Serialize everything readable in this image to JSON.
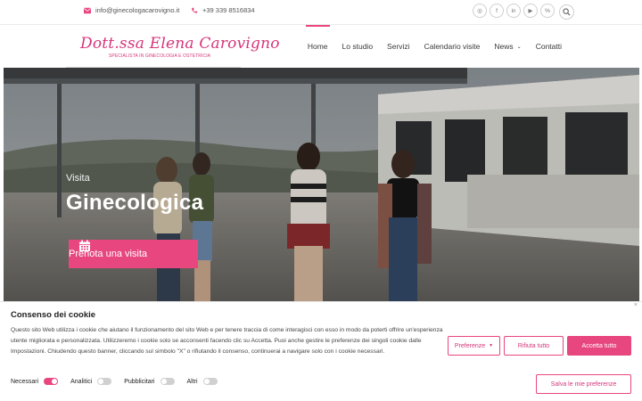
{
  "topbar": {
    "email": "info@ginecologacarovigno.it",
    "phone": "+39 339 8516834",
    "social": [
      {
        "name": "instagram-icon",
        "glyph": "◎"
      },
      {
        "name": "facebook-icon",
        "glyph": "f"
      },
      {
        "name": "linkedin-icon",
        "glyph": "in"
      },
      {
        "name": "youtube-icon",
        "glyph": "▶"
      },
      {
        "name": "link-icon",
        "glyph": "%"
      }
    ]
  },
  "logo": {
    "script": "Dott.ssa Elena Carovigno",
    "tagline": "SPECIALISTA IN GINECOLOGIA E OSTETRICIA"
  },
  "nav": {
    "items": [
      "Home",
      "Lo studio",
      "Servizi",
      "Calendario visite",
      "News",
      "Contatti"
    ],
    "chevron": "⌄"
  },
  "hero": {
    "kicker": "Visita",
    "title": "Ginecologica",
    "cta_label": "Prenota una visita"
  },
  "cookie": {
    "title": "Consenso dei cookie",
    "close": "×",
    "text": "Questo sito Web utilizza i cookie che aiutano il funzionamento del sito Web e per tenere traccia di come interagisci con esso in modo da poterti offrire un'esperienza utente migliorata e personalizzata. Utilizzeremo i cookie solo se acconsenti facendo clic su Accetta. Puoi anche gestire le preferenze dei singoli cookie dalle Impostazioni. Chiudendo questo banner, cliccando sul simbolo \"X\" o rifiutando il consenso, continuerai a navigare solo con i cookie necessari.",
    "toggles": [
      {
        "label": "Necessari",
        "on": true
      },
      {
        "label": "Analitici",
        "on": false
      },
      {
        "label": "Pubblicitari",
        "on": false
      },
      {
        "label": "Altri",
        "on": false
      }
    ],
    "preferences_label": "Preferenze",
    "reject_label": "Rifiuta tutto",
    "accept_label": "Accetta tutto",
    "save_label": "Salva le mie preferenze"
  },
  "colors": {
    "accent": "#e8467f",
    "logo": "#d6357a"
  }
}
